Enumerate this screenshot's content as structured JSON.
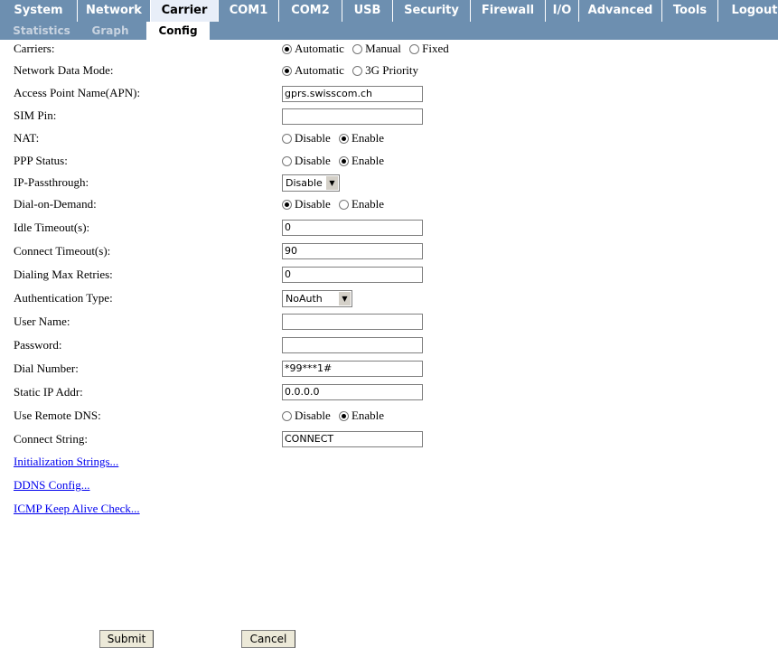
{
  "tabs": [
    "System",
    "Network",
    "Carrier",
    "COM1",
    "COM2",
    "USB",
    "Security",
    "Firewall",
    "I/O",
    "Advanced",
    "Tools",
    "Logout"
  ],
  "subtabs": [
    "Statistics",
    "Graph",
    "Config"
  ],
  "fields": {
    "carriers": {
      "label": "Carriers:",
      "options": [
        "Automatic",
        "Manual",
        "Fixed"
      ],
      "selected": "Automatic"
    },
    "network_data_mode": {
      "label": "Network Data Mode:",
      "options": [
        "Automatic",
        "3G Priority"
      ],
      "selected": "Automatic"
    },
    "apn": {
      "label": "Access Point Name(APN):",
      "value": "gprs.swisscom.ch"
    },
    "sim_pin": {
      "label": "SIM Pin:",
      "value": ""
    },
    "nat": {
      "label": "NAT:",
      "options": [
        "Disable",
        "Enable"
      ],
      "selected": "Enable"
    },
    "ppp_status": {
      "label": "PPP Status:",
      "options": [
        "Disable",
        "Enable"
      ],
      "selected": "Enable"
    },
    "ip_passthrough": {
      "label": "IP-Passthrough:",
      "value": "Disable"
    },
    "dial_on_demand": {
      "label": "Dial-on-Demand:",
      "options": [
        "Disable",
        "Enable"
      ],
      "selected": "Disable"
    },
    "idle_timeout": {
      "label": "Idle Timeout(s):",
      "value": "0"
    },
    "connect_timeout": {
      "label": "Connect Timeout(s):",
      "value": "90"
    },
    "dial_max_retries": {
      "label": "Dialing Max Retries:",
      "value": "0"
    },
    "auth_type": {
      "label": "Authentication Type:",
      "value": "NoAuth"
    },
    "user_name": {
      "label": "User Name:",
      "value": ""
    },
    "password": {
      "label": "Password:",
      "value": ""
    },
    "dial_number": {
      "label": "Dial Number:",
      "value": "*99***1#"
    },
    "static_ip": {
      "label": "Static IP Addr:",
      "value": "0.0.0.0"
    },
    "remote_dns": {
      "label": "Use Remote DNS:",
      "options": [
        "Disable",
        "Enable"
      ],
      "selected": "Enable"
    },
    "connect_string": {
      "label": "Connect String:",
      "value": "CONNECT"
    }
  },
  "links": [
    "Initialization Strings...",
    "DDNS Config...",
    "ICMP Keep Alive Check..."
  ],
  "buttons": {
    "submit": "Submit",
    "cancel": "Cancel"
  },
  "colors": {
    "tab_bar": "#6d8fb0",
    "tab_active": "#e8eef8",
    "link": "#0000ee"
  }
}
